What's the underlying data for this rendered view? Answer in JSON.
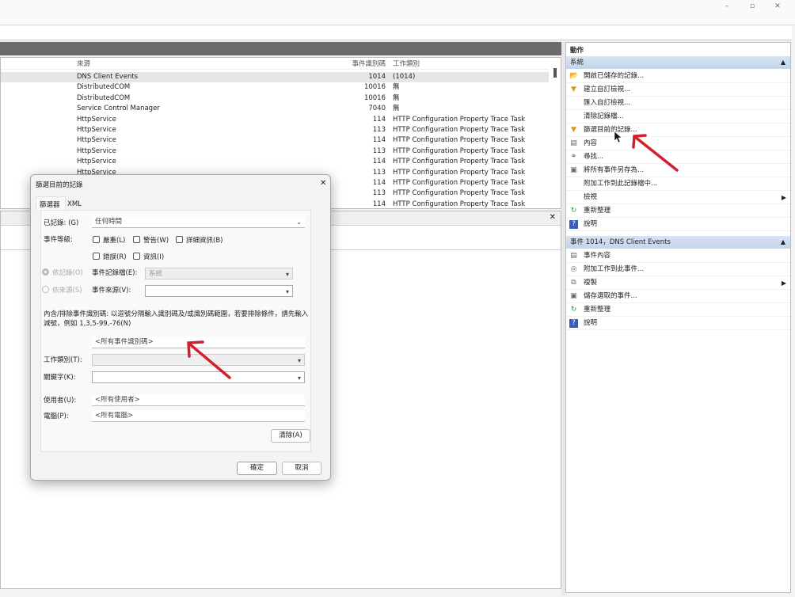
{
  "window_controls": {
    "minimize": "–",
    "maximize": "▫",
    "close": "✕"
  },
  "events_table": {
    "headers": {
      "source": "來源",
      "event_id": "事件識別碼",
      "task_category": "工作類別"
    },
    "rows": [
      {
        "source": "DNS Client Events",
        "event_id": "1014",
        "task": "(1014)"
      },
      {
        "source": "DistributedCOM",
        "event_id": "10016",
        "task": "無"
      },
      {
        "source": "DistributedCOM",
        "event_id": "10016",
        "task": "無"
      },
      {
        "source": "Service Control Manager",
        "event_id": "7040",
        "task": "無"
      },
      {
        "source": "HttpService",
        "event_id": "114",
        "task": "HTTP Configuration Property Trace Task"
      },
      {
        "source": "HttpService",
        "event_id": "113",
        "task": "HTTP Configuration Property Trace Task"
      },
      {
        "source": "HttpService",
        "event_id": "114",
        "task": "HTTP Configuration Property Trace Task"
      },
      {
        "source": "HttpService",
        "event_id": "113",
        "task": "HTTP Configuration Property Trace Task"
      },
      {
        "source": "HttpService",
        "event_id": "114",
        "task": "HTTP Configuration Property Trace Task"
      },
      {
        "source": "HttpService",
        "event_id": "113",
        "task": "HTTP Configuration Property Trace Task"
      },
      {
        "source": "",
        "event_id": "114",
        "task": "HTTP Configuration Property Trace Task"
      },
      {
        "source": "",
        "event_id": "113",
        "task": "HTTP Configuration Property Trace Task"
      },
      {
        "source": "",
        "event_id": "114",
        "task": "HTTP Configuration Property Trace Task"
      }
    ]
  },
  "lower_pane": {
    "close": "✕"
  },
  "actions": {
    "title": "動作",
    "section1": {
      "title": "系統",
      "items": [
        {
          "label": "開啟已儲存的記錄...",
          "icon": "open-folder-icon",
          "glyph": "📂"
        },
        {
          "label": "建立自訂檢視...",
          "icon": "filter-icon",
          "glyph": "▼"
        },
        {
          "label": "匯入自訂檢視...",
          "icon": "",
          "glyph": ""
        },
        {
          "label": "清除記錄檔...",
          "icon": "",
          "glyph": ""
        },
        {
          "label": "篩選目前的記錄...",
          "icon": "filter-icon",
          "glyph": "▼"
        },
        {
          "label": "內容",
          "icon": "properties-icon",
          "glyph": "▤"
        },
        {
          "label": "尋找...",
          "icon": "binoculars-icon",
          "glyph": "⚭"
        },
        {
          "label": "將所有事件另存為...",
          "icon": "save-icon",
          "glyph": "▣"
        },
        {
          "label": "附加工作到此記錄檔中...",
          "icon": "",
          "glyph": ""
        },
        {
          "label": "檢視",
          "icon": "",
          "glyph": "",
          "submenu": "▶"
        },
        {
          "label": "重新整理",
          "icon": "refresh-icon",
          "glyph": "↻"
        },
        {
          "label": "說明",
          "icon": "help-icon",
          "glyph": "?"
        }
      ]
    },
    "section2": {
      "title": "事件 1014，DNS Client Events",
      "items": [
        {
          "label": "事件內容",
          "icon": "properties-icon",
          "glyph": "▤"
        },
        {
          "label": "附加工作到此事件...",
          "icon": "task-icon",
          "glyph": "◎"
        },
        {
          "label": "複製",
          "icon": "copy-icon",
          "glyph": "⧉",
          "submenu": "▶"
        },
        {
          "label": "儲存選取的事件...",
          "icon": "save-icon",
          "glyph": "▣"
        },
        {
          "label": "重新整理",
          "icon": "refresh-icon",
          "glyph": "↻"
        },
        {
          "label": "說明",
          "icon": "help-icon",
          "glyph": "?"
        }
      ]
    }
  },
  "dialog": {
    "title": "篩選目前的記錄",
    "close": "✕",
    "tabs": [
      "篩選器",
      "XML"
    ],
    "logged_label": "已記錄: (G)",
    "logged_value": "任何時間",
    "level_label": "事件等級:",
    "levels": [
      "嚴重(L)",
      "警告(W)",
      "詳細資訊(B)",
      "錯誤(R)",
      "資訊(I)"
    ],
    "by_log_label": "依記錄(O)",
    "by_source_label": "依來源(S)",
    "event_logs_label": "事件記錄檔(E):",
    "event_logs_value": "系統",
    "event_sources_label": "事件來源(V):",
    "event_sources_value": "",
    "description": "內含/排除事件識別碼: 以逗號分隔輸入識別碼及/或識別碼範圍，若要排除條件，請先輸入減號，例如 1,3,5-99,-76(N)",
    "event_ids_value": "<所有事件識別碼>",
    "task_category_label": "工作類別(T):",
    "keywords_label": "關鍵字(K):",
    "user_label": "使用者(U):",
    "user_value": "<所有使用者>",
    "computer_label": "電腦(P):",
    "computer_value": "<所有電腦>",
    "clear_button": "清除(A)",
    "ok_button": "確定",
    "cancel_button": "取消"
  },
  "colors": {
    "annotation_arrow": "#d0202e",
    "section_header": "#c9d9ec"
  }
}
